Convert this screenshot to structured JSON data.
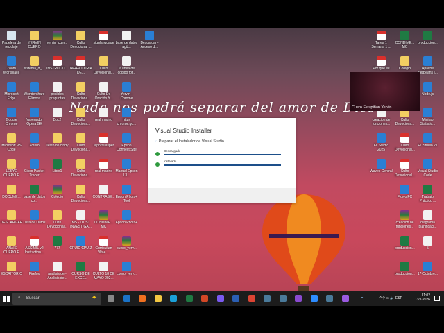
{
  "wallpaper_text": "Nada nos podrá separar del amor de Dios.",
  "left_icons": [
    [
      "Papelera de reciclaje",
      "YERVIN CUERO",
      "yervin_cuer...",
      "Culto Devocional ...",
      "signlanguage",
      "base de datos agü...",
      "Descargar - Acceso di..."
    ],
    [
      "Zoom Workplace",
      "sistema_d_...",
      "INSTRUCTI...",
      "TAREA CURIA DE...",
      "Culto Devocional...",
      "la línea de código for..."
    ],
    [
      "Microsoft Edge",
      "Wondershare Filmora",
      "posibles preguntas",
      "Culto Devociona...",
      "Culto De Oración Y...",
      "Yervin - Chrome"
    ],
    [
      "Google Chrome",
      "Navegador Opera GX",
      "Doc2",
      "Culto Devociona...",
      "real madrid",
      "https chrome.go..."
    ],
    [
      "Microsoft VS Code",
      "Zotero",
      "Texto de cindy",
      "Culto Devociona...",
      "reportelasper",
      "Epson Connect Site"
    ],
    [
      "LESYE CUERO E",
      "Cisco Packet Tracer",
      "Libro1",
      "Culto Devociona...",
      "real madrid",
      "Manual Epson L3..."
    ],
    [
      "DOCUME...",
      "base de datos co...",
      "Colegio",
      "Culto Devociona...",
      "CONTRASE...",
      "Epson Photo+ Tool"
    ],
    [
      "DESCARGAR",
      "Lista de Datos",
      "Culto Devocional...",
      "MS - U1 S1 INVESTIGA...",
      "CONDIME... MC",
      "Epson Photo+"
    ],
    [
      "ANAIS CUERO E",
      "ASSIMIL v2 Instruction...",
      "777",
      "CPUID CPU-Z",
      "Curriculum Vitae ...",
      "cuero_yerv..."
    ],
    [
      "ESCRITORIO",
      "Firefox",
      "analisis de - Analisis de...",
      "CURSO DE EXCEL",
      "CULTO 18 DE MAYO 202...",
      "cuero_yerv..."
    ]
  ],
  "left_types": [
    [
      "recycle",
      "folder",
      "zip",
      "folder",
      "pdf",
      "doc",
      "app"
    ],
    [
      "app",
      "folder",
      "pdf",
      "pdf",
      "folder",
      "doc"
    ],
    [
      "app",
      "app",
      "doc",
      "folder",
      "doc",
      "app"
    ],
    [
      "app",
      "app",
      "doc",
      "folder",
      "doc",
      "app"
    ],
    [
      "folder",
      "app",
      "folder",
      "folder",
      "pdf",
      "app"
    ],
    [
      "folder",
      "app",
      "excel",
      "folder",
      "pdf",
      "app"
    ],
    [
      "folder",
      "excel",
      "zip",
      "folder",
      "doc",
      "app"
    ],
    [
      "folder",
      "app",
      "folder",
      "doc",
      "zip",
      "app"
    ],
    [
      "folder",
      "pdf",
      "excel",
      "app",
      "pdf",
      "zip"
    ],
    [
      "folder",
      "app",
      "doc",
      "excel",
      "doc",
      "app"
    ]
  ],
  "right_icons": [
    [
      "Tarea 1 Semana 1 ...",
      "CONDIME... MC",
      "produccion..."
    ],
    [
      "Por qué es",
      "Colegio",
      "Apache NetBeans I..."
    ],
    [
      "",
      "",
      "Node.js"
    ],
    [
      "creacion de funciones...",
      "Culto Devociona...",
      "Minitab Statistic..."
    ],
    [
      "FL Studio 2025",
      "Culto Devocional...",
      "FL Studio 21"
    ],
    [
      "Waves Central",
      "Culto Devocional...",
      "Visual Studio Code"
    ],
    [
      "",
      "FlowolFC",
      "Trabajo Práctico ..."
    ],
    [
      "",
      "creacion de funciones...",
      "diagrama planificaci..."
    ],
    [
      "",
      "produccion...",
      "5"
    ],
    [
      "",
      "produccion...",
      "17-Octubre..."
    ]
  ],
  "right_types": [
    [
      "pdf",
      "excel",
      "excel"
    ],
    [
      "pdf",
      "folder",
      "app"
    ],
    [
      "",
      "",
      "app"
    ],
    [
      "doc",
      "folder",
      "app"
    ],
    [
      "app",
      "pdf",
      "app"
    ],
    [
      "app",
      "pdf",
      "app"
    ],
    [
      "",
      "app",
      "excel"
    ],
    [
      "",
      "zip",
      "doc"
    ],
    [
      "",
      "excel",
      "doc"
    ],
    [
      "",
      "excel",
      "app"
    ]
  ],
  "video_overlay": {
    "name": "Cuero Estupiñan Yervin"
  },
  "dialog": {
    "title": "Visual Studio Installer",
    "status": "Preparar el Instalador de Visual Studio.",
    "steps": [
      {
        "label": "Descargado",
        "progress": 100
      },
      {
        "label": "Instalado",
        "progress": 100
      }
    ]
  },
  "taskbar": {
    "search_placeholder": "Buscar",
    "language": "ESP",
    "time": "11:02",
    "date": "13/1/2026",
    "apps": [
      "task-view",
      "outlook",
      "firefox",
      "file-explorer",
      "edge",
      "excel",
      "powerpoint",
      "copilot",
      "word",
      "chrome",
      "app",
      "app",
      "visual-studio",
      "zoom",
      "app",
      "visual-studio-installer"
    ]
  }
}
